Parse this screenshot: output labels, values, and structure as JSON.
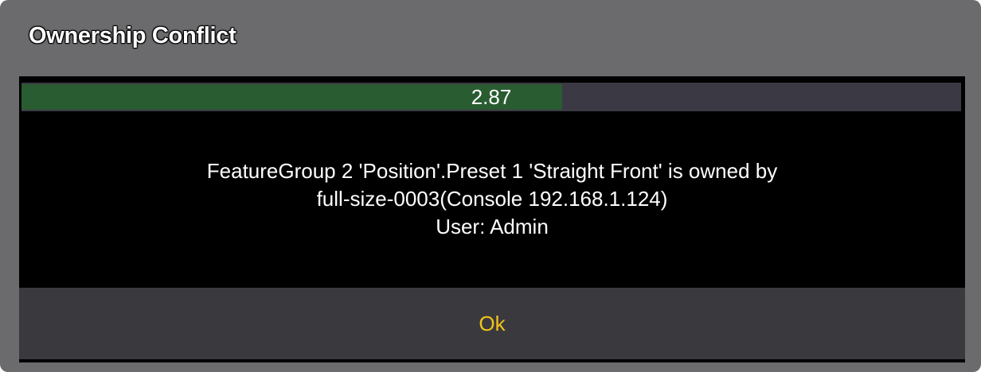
{
  "dialog": {
    "title": "Ownership Conflict",
    "progress": {
      "label": "2.87",
      "fraction": 0.575
    },
    "message_lines": [
      "FeatureGroup 2 'Position'.Preset 1 'Straight Front' is owned by",
      "full-size-0003(Console 192.168.1.124)",
      "User: Admin"
    ],
    "ok_label": "Ok"
  },
  "colors": {
    "frame": "#6b6b6d",
    "panel": "#000000",
    "progress_track": "#3b3a44",
    "progress_fill": "#2a5c32",
    "button_bg": "#3a3a3e",
    "button_text": "#f2c31a"
  }
}
